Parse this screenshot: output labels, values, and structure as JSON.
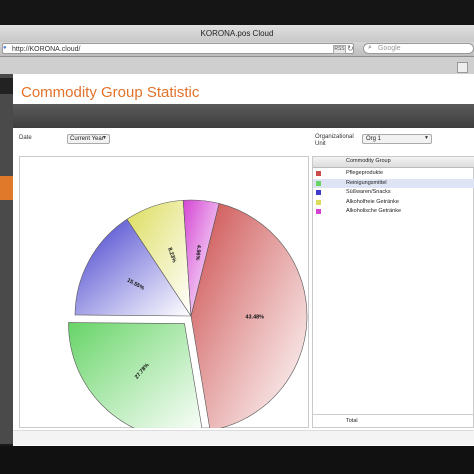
{
  "window": {
    "title": "KORONA.pos Cloud"
  },
  "browser": {
    "url": "http://KORONA.cloud/",
    "rss_badge": "RSS",
    "search_placeholder": "Google"
  },
  "page": {
    "title": "Commodity Group Statistic",
    "filters": {
      "date_label": "Date",
      "date_value": "Current Year",
      "org_label": "Organizational Unit",
      "org_value": "Org 1"
    },
    "legend": {
      "column_header": "Commodity Group",
      "total_label": "Total"
    }
  },
  "chart_data": {
    "type": "pie",
    "exploded": true,
    "slices": [
      {
        "label": "Pflegeprodukte",
        "value": 43.48,
        "display": "43.48%",
        "color": "#cc4b4b"
      },
      {
        "label": "Reinigungsmittel",
        "value": 27.78,
        "display": "27.78%",
        "color": "#66d466"
      },
      {
        "label": "Süßwaren/Snacks",
        "value": 15.55,
        "display": "15.55%",
        "color": "#3f3acc"
      },
      {
        "label": "Alkoholfreie Getränke",
        "value": 8.23,
        "display": "8.23%",
        "color": "#dcdc5a"
      },
      {
        "label": "Alkoholische Getränke",
        "value": 4.96,
        "display": "4.96%",
        "color": "#d444d4"
      }
    ]
  }
}
